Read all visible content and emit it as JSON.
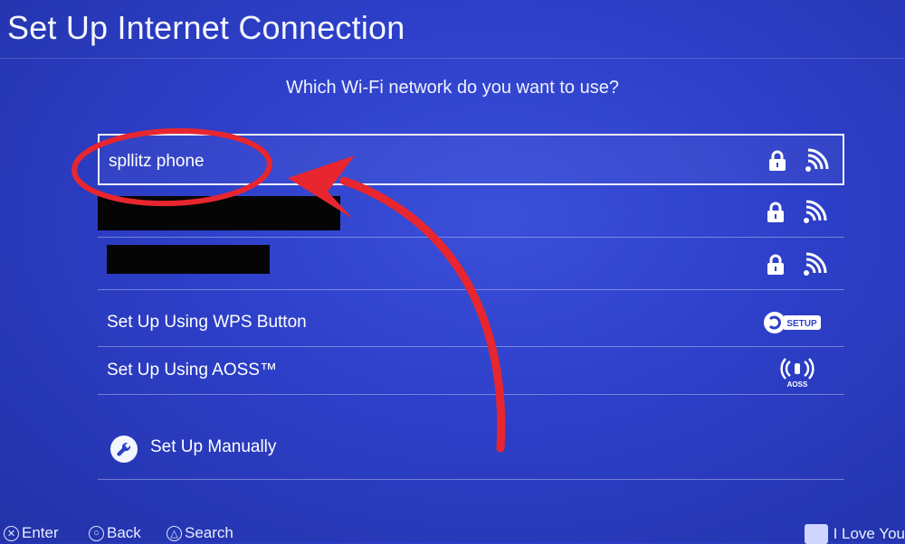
{
  "window": {
    "title": "Set Up Internet Connection"
  },
  "prompt": {
    "question": "Which Wi-Fi network do you want to use?"
  },
  "networks": [
    {
      "name": "spllitz phone",
      "selected": true,
      "secured": true,
      "icons": [
        "lock-icon",
        "wifi-signal-icon"
      ]
    },
    {
      "name": "",
      "redacted": true,
      "secured": true,
      "icons": [
        "lock-icon",
        "wifi-signal-icon"
      ]
    },
    {
      "name": "",
      "redacted": true,
      "secured": true,
      "icons": [
        "lock-icon",
        "wifi-signal-icon"
      ]
    }
  ],
  "options": {
    "wps": {
      "label": "Set Up Using WPS Button",
      "icon": "wps-setup-icon",
      "icon_text": "SETUP"
    },
    "aoss": {
      "label": "Set Up Using AOSS™",
      "icon": "aoss-icon",
      "icon_text": "AOSS"
    },
    "manual": {
      "label": "Set Up Manually",
      "icon": "wrench-icon"
    }
  },
  "footer": {
    "enter": {
      "symbol": "✕",
      "label": "Enter"
    },
    "back": {
      "symbol": "○",
      "label": "Back"
    },
    "search": {
      "symbol": "△",
      "label": "Search"
    },
    "user": "I Love You"
  },
  "colors": {
    "background": "#2d3fc8",
    "text": "#f4f6ff",
    "annotation": "#e8262f",
    "redaction": "#050505"
  }
}
